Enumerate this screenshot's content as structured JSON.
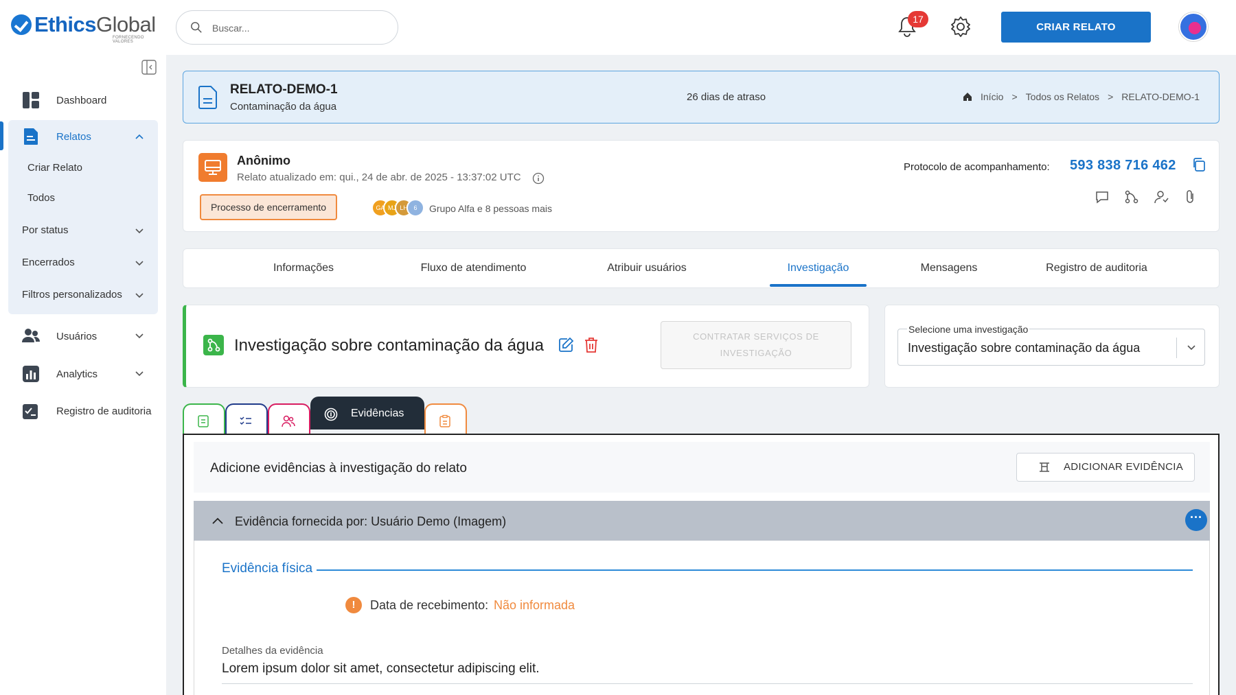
{
  "header": {
    "logo": {
      "brand_a": "Ethics",
      "brand_b": "Global",
      "tagline": "FORNECENDO VALORES"
    },
    "search_placeholder": "Buscar...",
    "notifications_count": "17",
    "create_button": "CRIAR RELATO"
  },
  "sidebar": {
    "dashboard": "Dashboard",
    "reports": "Relatos",
    "create_report": "Criar Relato",
    "all": "Todos",
    "by_status": "Por status",
    "closed": "Encerrados",
    "custom_filters": "Filtros personalizados",
    "users": "Usuários",
    "analytics": "Analytics",
    "audit": "Registro de auditoria"
  },
  "report_header": {
    "id": "RELATO-DEMO-1",
    "subtitle": "Contaminação da água",
    "delay": "26 dias de atraso",
    "breadcrumb": [
      "Início",
      "Todos os Relatos",
      "RELATO-DEMO-1"
    ],
    "separator": ">"
  },
  "reporter": {
    "name": "Anônimo",
    "updated": "Relato atualizado em: qui., 24 de abr. de 2025 - 13:37:02 UTC",
    "status": "Processo de encerramento",
    "assignees": [
      {
        "initials": "GA",
        "color": "#f0a020"
      },
      {
        "initials": "MJ",
        "color": "#e8a317"
      },
      {
        "initials": "LH",
        "color": "#d49a3a"
      },
      {
        "initials": "6",
        "color": "#8fb3e0"
      }
    ],
    "group_text": "Grupo Alfa e 8 pessoas mais",
    "protocol_label": "Protocolo de acompanhamento:",
    "protocol_value": "593 838 716 462"
  },
  "tabs": [
    "Informações",
    "Fluxo de atendimento",
    "Atribuir usuários",
    "Investigação",
    "Mensagens",
    "Registro de auditoria"
  ],
  "investigation": {
    "title": "Investigação sobre contaminação da água",
    "contract_button": "CONTRATAR SERVIÇOS DE INVESTIGAÇÃO",
    "select_label": "Selecione uma investigação",
    "select_value": "Investigação sobre contaminação da água"
  },
  "evidence": {
    "tab_label": "Evidências",
    "heading": "Adicione evidências à investigação do relato",
    "add_button": "ADICIONAR EVIDÊNCIA",
    "accordion_title": "Evidência fornecida por: Usuário Demo (Imagem)",
    "section": "Evidência física",
    "received_label": "Data de recebimento:",
    "received_value": "Não informada",
    "details_label": "Detalhes da evidência",
    "details_value": "Lorem ipsum dolor sit amet, consectetur adipiscing elit."
  },
  "colors": {
    "primary": "#1a73c8",
    "warning": "#f08a3e",
    "success": "#3bb54a",
    "danger": "#e53935"
  }
}
